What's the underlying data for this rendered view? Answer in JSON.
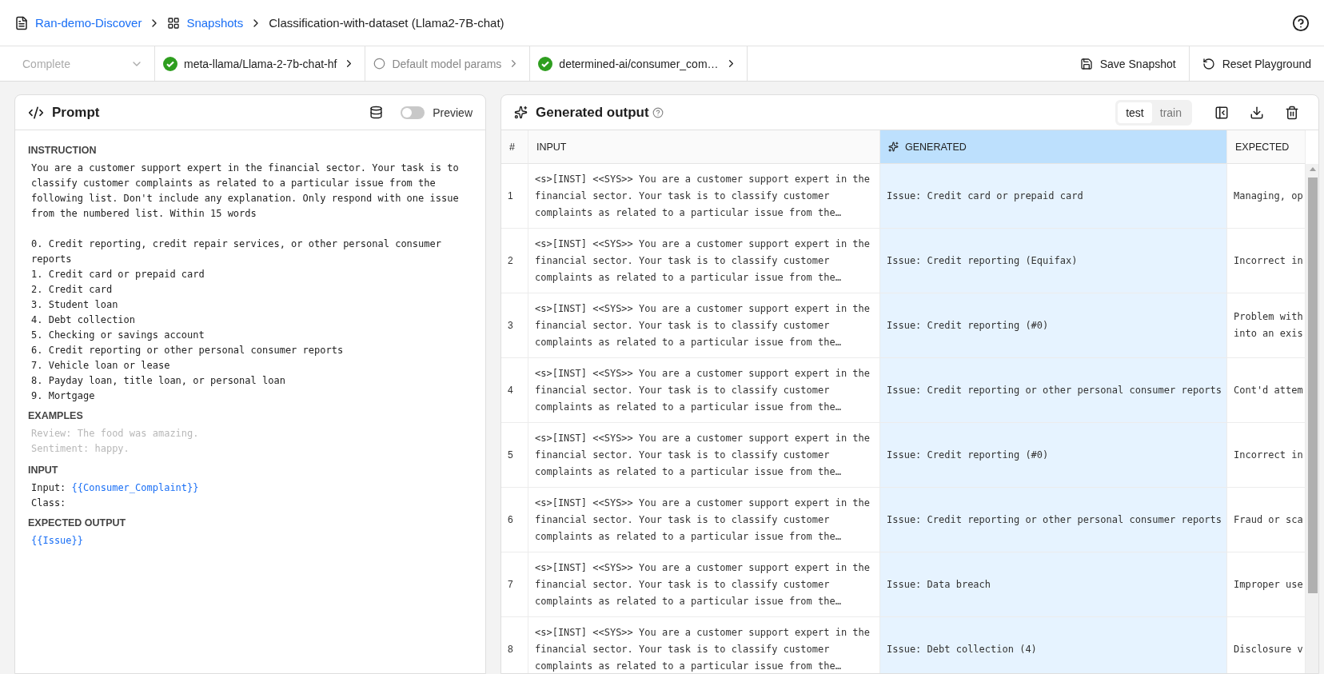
{
  "breadcrumb": [
    {
      "label": "Ran-demo-Discover",
      "kind": "project",
      "link": true
    },
    {
      "label": "Snapshots",
      "kind": "snapshots",
      "link": true
    },
    {
      "label": "Classification-with-dataset (Llama2-7B-chat)",
      "kind": "current",
      "link": false
    }
  ],
  "toolbar": {
    "mode": {
      "value": "Complete",
      "disabled": true
    },
    "steps": [
      {
        "label": "meta-llama/Llama-2-7b-chat-hf",
        "done": true
      },
      {
        "label": "Default model params",
        "done": false
      },
      {
        "label": "determined-ai/consumer_com…",
        "done": true
      }
    ],
    "actions": [
      {
        "label": "Save Snapshot",
        "kind": "save"
      },
      {
        "label": "Reset Playground",
        "kind": "reset"
      }
    ]
  },
  "prompt": {
    "title": "Prompt",
    "preview": {
      "label": "Preview",
      "on": false
    },
    "sections": [
      {
        "heading": "INSTRUCTION",
        "kind": "text",
        "text": "You are a customer support expert in the financial sector. Your task is to classify customer complaints as related to a particular issue from the following list. Don't include any explanation. Only respond with one issue from the numbered list. Within 15 words\n\n0. Credit reporting, credit repair services, or other personal consumer reports\n1. Credit card or prepaid card\n2. Credit card\n3. Student loan\n4. Debt collection\n5. Checking or savings account\n6. Credit reporting or other personal consumer reports\n7. Vehicle loan or lease\n8. Payday loan, title loan, or personal loan\n9. Mortgage"
      },
      {
        "heading": "EXAMPLES",
        "kind": "field",
        "placeholder": "Review: The food was amazing.\nSentiment: happy."
      },
      {
        "heading": "INPUT",
        "kind": "template",
        "lines": [
          [
            {
              "text": "Input: ",
              "kind": "plain"
            },
            {
              "text": "{{Consumer_Complaint}}",
              "kind": "variable"
            }
          ],
          [
            {
              "text": "Class:",
              "kind": "plain"
            }
          ]
        ]
      },
      {
        "heading": "EXPECTED OUTPUT",
        "kind": "template",
        "lines": [
          [
            {
              "text": "{{Issue}}",
              "kind": "variable"
            }
          ]
        ]
      }
    ]
  },
  "output": {
    "title": "Generated output",
    "splits": [
      {
        "label": "test",
        "selected": true
      },
      {
        "label": "train",
        "selected": false
      }
    ],
    "columns": [
      {
        "label": "#",
        "highlighted": false
      },
      {
        "label": "INPUT",
        "highlighted": false
      },
      {
        "label": "GENERATED",
        "highlighted": true
      },
      {
        "label": "EXPECTED",
        "highlighted": false
      }
    ],
    "rows": [
      {
        "index": "1",
        "input": "<s>[INST] <<SYS>> You are a customer support expert in the financial sector. Your task is to classify customer complaints as related to a particular issue from the…",
        "generated": "Issue: Credit card or prepaid card",
        "expected": "Managing, op"
      },
      {
        "index": "2",
        "input": "<s>[INST] <<SYS>> You are a customer support expert in the financial sector. Your task is to classify customer complaints as related to a particular issue from the…",
        "generated": "Issue: Credit reporting (Equifax)",
        "expected": "Incorrect in"
      },
      {
        "index": "3",
        "input": "<s>[INST] <<SYS>> You are a customer support expert in the financial sector. Your task is to classify customer complaints as related to a particular issue from the…",
        "generated": "Issue: Credit reporting (#0)",
        "expected": "Problem with\ninto an exis"
      },
      {
        "index": "4",
        "input": "<s>[INST] <<SYS>> You are a customer support expert in the financial sector. Your task is to classify customer complaints as related to a particular issue from the…",
        "generated": "Issue: Credit reporting or other personal consumer reports",
        "expected": "Cont'd attem"
      },
      {
        "index": "5",
        "input": "<s>[INST] <<SYS>> You are a customer support expert in the financial sector. Your task is to classify customer complaints as related to a particular issue from the…",
        "generated": "Issue: Credit reporting (#0)",
        "expected": "Incorrect in"
      },
      {
        "index": "6",
        "input": "<s>[INST] <<SYS>> You are a customer support expert in the financial sector. Your task is to classify customer complaints as related to a particular issue from the…",
        "generated": "Issue: Credit reporting or other personal consumer reports",
        "expected": "Fraud or sca"
      },
      {
        "index": "7",
        "input": "<s>[INST] <<SYS>> You are a customer support expert in the financial sector. Your task is to classify customer complaints as related to a particular issue from the…",
        "generated": "Issue: Data breach",
        "expected": "Improper use"
      },
      {
        "index": "8",
        "input": "<s>[INST] <<SYS>> You are a customer support expert in the financial sector. Your task is to classify customer complaints as related to a particular issue from the…",
        "generated": "Issue: Debt collection (4)",
        "expected": "Disclosure v"
      }
    ]
  }
}
